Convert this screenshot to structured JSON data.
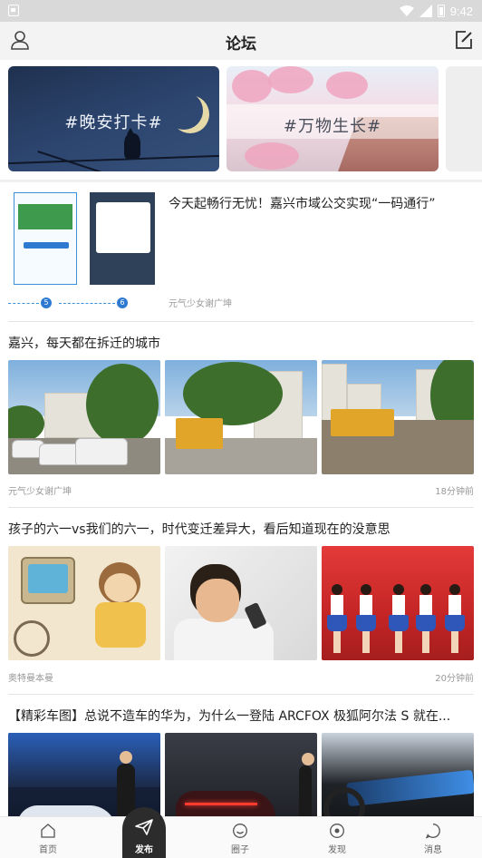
{
  "status_bar": {
    "time": "9:42"
  },
  "header": {
    "title": "论坛"
  },
  "banners": [
    {
      "text": "#晚安打卡#"
    },
    {
      "text": "#万物生长#"
    }
  ],
  "posts": [
    {
      "title": "今天起畅行无忧！嘉兴市域公交实现“一码通行”",
      "author": "元气少女谢广坤",
      "step_numbers": [
        "5",
        "6"
      ]
    },
    {
      "title": "嘉兴，每天都在拆迁的城市",
      "author": "元气少女谢广坤",
      "time": "18分钟前"
    },
    {
      "title": "孩子的六一vs我们的六一，时代变迁差异大，看后知道现在的没意思",
      "author": "奥特曼本曼",
      "time": "20分钟前"
    },
    {
      "title": "【精彩车图】总说不造车的华为，为什么一登陆 ARCFOX 极狐阿尔法 S 就在..."
    }
  ],
  "tabs": {
    "home": "首页",
    "publish": "发布",
    "circle": "圈子",
    "discover": "发现",
    "messages": "消息"
  },
  "colors": {
    "accent_dark": "#2c2c2c",
    "header_bg": "#f3f3f3",
    "status_bar_bg": "#d9d9d9"
  }
}
